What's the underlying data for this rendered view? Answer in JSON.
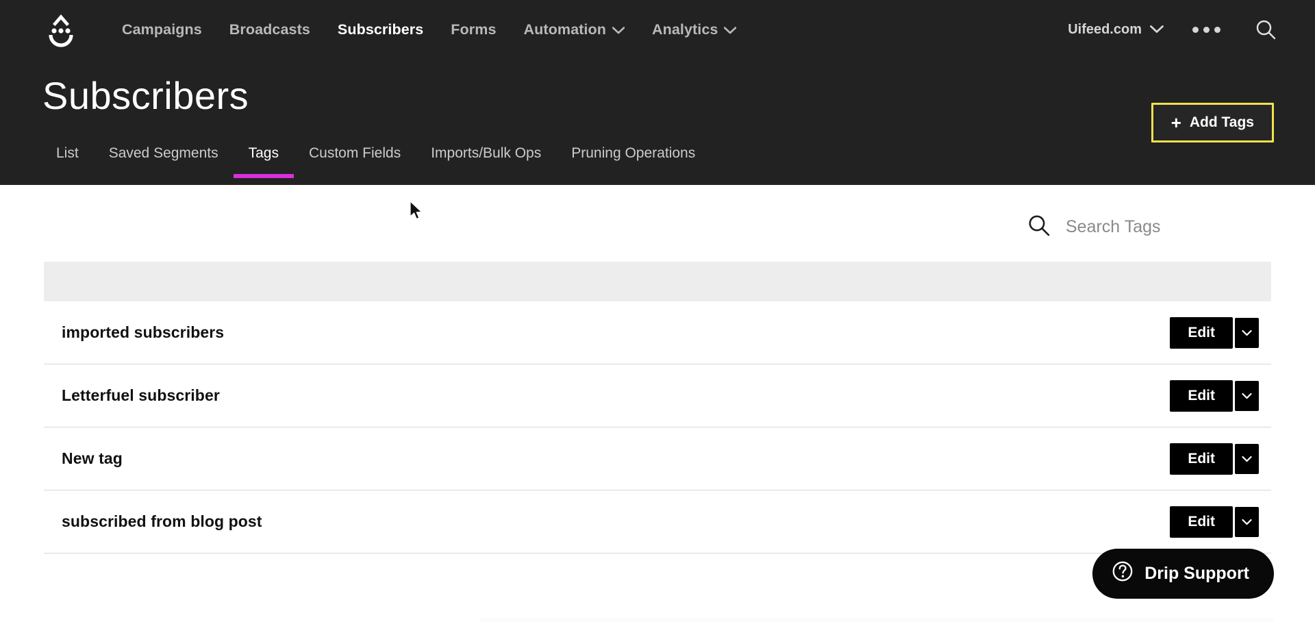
{
  "header": {
    "logo_icon": "drip-face-logo",
    "nav": [
      {
        "label": "Campaigns",
        "active": false,
        "has_chevron": false
      },
      {
        "label": "Broadcasts",
        "active": false,
        "has_chevron": false
      },
      {
        "label": "Subscribers",
        "active": true,
        "has_chevron": false
      },
      {
        "label": "Forms",
        "active": false,
        "has_chevron": false
      },
      {
        "label": "Automation",
        "active": false,
        "has_chevron": true
      },
      {
        "label": "Analytics",
        "active": false,
        "has_chevron": true
      }
    ],
    "account": "Uifeed.com",
    "account_chevron_icon": "chevron-down-icon",
    "more_icon": "three-dots-icon",
    "search_icon": "search-icon"
  },
  "page": {
    "title": "Subscribers",
    "add_button": "Add Tags",
    "add_button_plus": "+",
    "add_button_border_color": "#f2e14c"
  },
  "tabs": {
    "active_underline_color": "#d92fd9",
    "items": [
      {
        "label": "List",
        "active": false
      },
      {
        "label": "Saved Segments",
        "active": false
      },
      {
        "label": "Tags",
        "active": true
      },
      {
        "label": "Custom Fields",
        "active": false
      },
      {
        "label": "Imports/Bulk Ops",
        "active": false
      },
      {
        "label": "Pruning Operations",
        "active": false
      }
    ]
  },
  "search": {
    "placeholder": "Search Tags",
    "value": "",
    "icon": "search-icon"
  },
  "table": {
    "header_row_label": "",
    "rows": [
      {
        "name": "imported subscribers",
        "edit_label": "Edit",
        "caret_icon": "chevron-down-icon"
      },
      {
        "name": "Letterfuel subscriber",
        "edit_label": "Edit",
        "caret_icon": "chevron-down-icon"
      },
      {
        "name": "New tag",
        "edit_label": "Edit",
        "caret_icon": "chevron-down-icon"
      },
      {
        "name": "subscribed from blog post",
        "edit_label": "Edit",
        "caret_icon": "chevron-down-icon"
      }
    ]
  },
  "support": {
    "label": "Drip Support",
    "icon": "question-circle-icon"
  }
}
